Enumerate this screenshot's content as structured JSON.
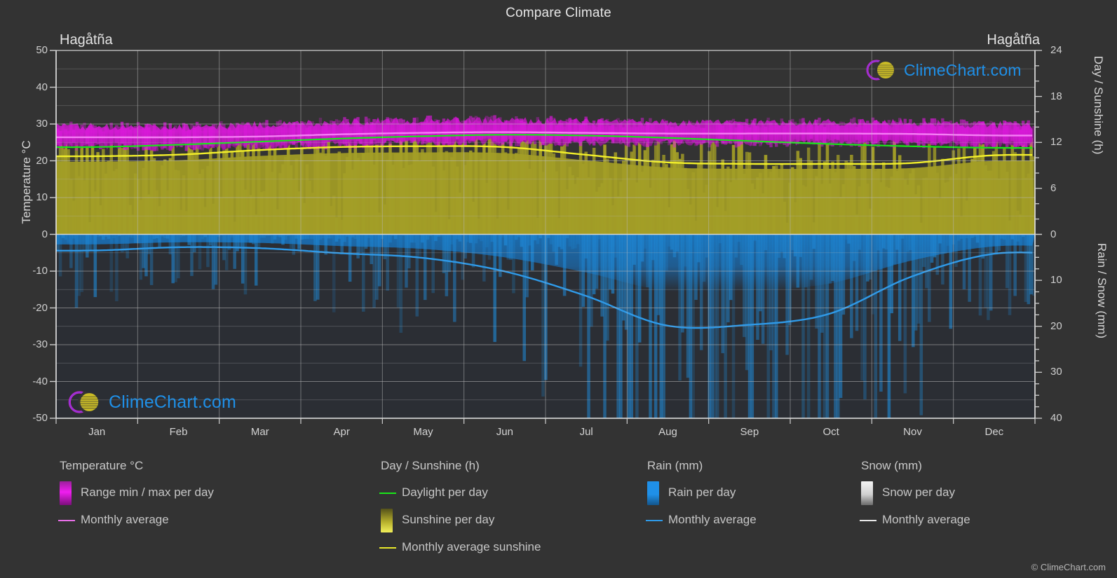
{
  "header": {
    "title": "Compare Climate",
    "city_left": "Hagåtña",
    "city_right": "Hagåtña"
  },
  "brand": {
    "name": "ClimeChart.com",
    "copyright": "© ClimeChart.com",
    "accent_blue": "#1f90e8",
    "accent_magenta": "#cc33cc",
    "accent_yellow": "#c9c02e"
  },
  "axes": {
    "left_title": "Temperature °C",
    "left_ticks": [
      "50",
      "40",
      "30",
      "20",
      "10",
      "0",
      "-10",
      "-20",
      "-30",
      "-40",
      "-50"
    ],
    "left_min": -50,
    "left_max": 50,
    "right_top_title": "Day / Sunshine (h)",
    "right_top_ticks": [
      "24",
      "18",
      "12",
      "6",
      "0"
    ],
    "right_top_min": 0,
    "right_top_max": 24,
    "right_bottom_title": "Rain / Snow (mm)",
    "right_bottom_ticks": [
      "0",
      "10",
      "20",
      "30",
      "40"
    ],
    "right_bottom_min": 0,
    "right_bottom_max": 40,
    "x_ticks": [
      "Jan",
      "Feb",
      "Mar",
      "Apr",
      "May",
      "Jun",
      "Jul",
      "Aug",
      "Sep",
      "Oct",
      "Nov",
      "Dec"
    ]
  },
  "legend": {
    "groups": [
      {
        "heading": "Temperature °C",
        "items": [
          {
            "label": "Range min / max per day",
            "kind": "swatch",
            "color": "#e612e6"
          },
          {
            "label": "Monthly average",
            "kind": "line",
            "color": "#e86fe8"
          }
        ]
      },
      {
        "heading": "Day / Sunshine (h)",
        "items": [
          {
            "label": "Daylight per day",
            "kind": "line",
            "color": "#19e619"
          },
          {
            "label": "Sunshine per day",
            "kind": "swatch",
            "color": "#f2f23a"
          },
          {
            "label": "Monthly average sunshine",
            "kind": "line",
            "color": "#e8e82a"
          }
        ]
      },
      {
        "heading": "Rain (mm)",
        "items": [
          {
            "label": "Rain per day",
            "kind": "swatch",
            "color": "#1f90e8"
          },
          {
            "label": "Monthly average",
            "kind": "line",
            "color": "#2f9ae8"
          }
        ]
      },
      {
        "heading": "Snow (mm)",
        "items": [
          {
            "label": "Snow per day",
            "kind": "swatch",
            "color": "#f0f0f0"
          },
          {
            "label": "Monthly average",
            "kind": "line",
            "color": "#e8e8e8"
          }
        ]
      }
    ]
  },
  "chart_data": {
    "type": "area",
    "title": "Compare Climate",
    "subtitle": "Hagåtña",
    "xlabel": "",
    "ylabel": "Temperature °C",
    "categories": [
      "Jan",
      "Feb",
      "Mar",
      "Apr",
      "May",
      "Jun",
      "Jul",
      "Aug",
      "Sep",
      "Oct",
      "Nov",
      "Dec"
    ],
    "axis_ranges": {
      "temperature_c": [
        -50,
        50
      ],
      "day_sunshine_h": [
        0,
        24
      ],
      "rain_snow_mm": [
        0,
        40
      ]
    },
    "grid": true,
    "legend_position": "bottom",
    "series": [
      {
        "name": "Monthly average temperature",
        "unit": "°C",
        "axis": "temperature_c",
        "color": "#e86fe8",
        "values": [
          26.4,
          26.4,
          26.6,
          27.2,
          27.6,
          27.8,
          27.6,
          27.4,
          27.4,
          27.4,
          27.3,
          26.9
        ]
      },
      {
        "name": "Daily max temperature",
        "unit": "°C",
        "axis": "temperature_c",
        "color": "#e612e6",
        "values": [
          29.3,
          29.3,
          29.8,
          30.5,
          31.0,
          31.0,
          30.6,
          30.3,
          30.4,
          30.5,
          30.4,
          29.8
        ]
      },
      {
        "name": "Daily min temperature",
        "unit": "°C",
        "axis": "temperature_c",
        "color": "#e612e6",
        "values": [
          23.9,
          23.7,
          23.9,
          24.4,
          24.9,
          25.1,
          24.9,
          24.8,
          24.8,
          24.8,
          24.7,
          24.3
        ]
      },
      {
        "name": "Daylight per day",
        "unit": "h",
        "axis": "day_sunshine_h",
        "color": "#19e619",
        "values": [
          11.4,
          11.7,
          12.1,
          12.5,
          12.8,
          13.0,
          12.9,
          12.6,
          12.2,
          11.8,
          11.5,
          11.3
        ]
      },
      {
        "name": "Monthly average sunshine",
        "unit": "h",
        "axis": "day_sunshine_h",
        "color": "#e8e82a",
        "values": [
          10.2,
          10.4,
          11.0,
          11.4,
          11.5,
          11.4,
          10.4,
          9.4,
          9.2,
          9.2,
          9.3,
          10.3
        ]
      },
      {
        "name": "Rain monthly average",
        "unit": "mm",
        "axis": "rain_snow_mm",
        "color": "#2f9ae8",
        "values": [
          3.5,
          2.8,
          3.0,
          4.1,
          5.1,
          8.0,
          13.3,
          19.8,
          19.7,
          17.3,
          9.3,
          4.3
        ]
      },
      {
        "name": "Snow monthly average",
        "unit": "mm",
        "axis": "rain_snow_mm",
        "color": "#e8e8e8",
        "values": [
          0,
          0,
          0,
          0,
          0,
          0,
          0,
          0,
          0,
          0,
          0,
          0
        ]
      }
    ]
  }
}
